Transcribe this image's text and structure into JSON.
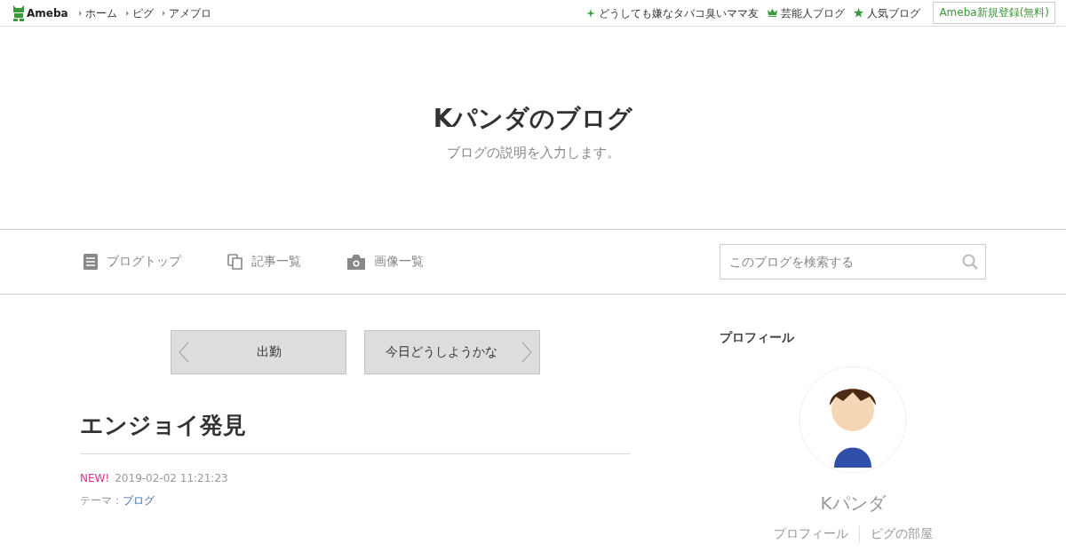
{
  "topbar": {
    "logo": "Ameba",
    "links": [
      "ホーム",
      "ピグ",
      "アメブロ"
    ],
    "right_links": [
      {
        "kind": "sparkle",
        "label": "どうしても嫌なタバコ臭いママ友"
      },
      {
        "kind": "crown",
        "label": "芸能人ブログ"
      },
      {
        "kind": "star",
        "label": "人気ブログ"
      }
    ],
    "signup": "Ameba新規登録(無料)"
  },
  "header": {
    "title": "Kパンダのブログ",
    "description": "ブログの説明を入力します。"
  },
  "nav": {
    "items": [
      {
        "kind": "doc",
        "label": "ブログトップ"
      },
      {
        "kind": "copy",
        "label": "記事一覧"
      },
      {
        "kind": "camera",
        "label": "画像一覧"
      }
    ],
    "search": {
      "placeholder": "このブログを検索する"
    }
  },
  "pager": {
    "prev": "出勤",
    "next": "今日どうしようかな"
  },
  "entry": {
    "title": "エンジョイ発見",
    "new_badge": "NEW!",
    "date": "2019-02-02 11:21:23",
    "theme_label": "テーマ：",
    "theme": "ブログ"
  },
  "profile": {
    "heading": "プロフィール",
    "name": "Kパンダ",
    "links": [
      "プロフィール",
      "ピグの部屋"
    ]
  }
}
